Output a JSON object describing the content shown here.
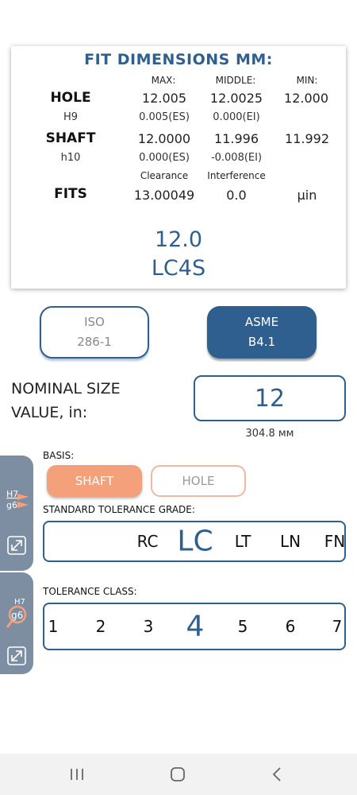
{
  "fit_card": {
    "title": "FIT DIMENSIONS MM:",
    "col_headers": {
      "max": "MAX:",
      "middle": "MIDDLE:",
      "min": "MIN:"
    },
    "hole": {
      "label": "HOLE",
      "grade": "H9",
      "max": "12.005",
      "middle": "12.0025",
      "min": "12.000",
      "dev_upper": "0.005(ES)",
      "dev_lower": "0.000(EI)"
    },
    "shaft": {
      "label": "SHAFT",
      "grade": "h10",
      "max": "12.0000",
      "middle": "11.996",
      "min": "11.992",
      "dev_upper": "0.000(ES)",
      "dev_lower": "-0.008(EI)"
    },
    "fits": {
      "label": "FITS",
      "clearance_header": "Clearance",
      "interference_header": "Interference",
      "clearance": "13.00049",
      "interference": "0.0",
      "unit": "µin"
    },
    "result_size": "12.0",
    "result_fit": "LC4S"
  },
  "standards": {
    "iso": {
      "line1": "ISO",
      "line2": "286-1",
      "selected": false
    },
    "asme": {
      "line1": "ASME",
      "line2": "B4.1",
      "selected": true
    }
  },
  "nominal": {
    "label_line1": "NOMINAL SIZE",
    "label_line2": "VALUE, in:",
    "value": "12",
    "converted": "304.8 мм"
  },
  "side_tabs": {
    "tab1_top": "H7",
    "tab1_bottom": "g6",
    "tab2_top": "H7",
    "tab2_bottom": "g6"
  },
  "basis": {
    "label": "BASIS:",
    "options": [
      "SHAFT",
      "HOLE"
    ],
    "selected": "SHAFT"
  },
  "grade": {
    "label": "STANDARD TOLERANCE GRADE:",
    "options": [
      "RC",
      "LC",
      "LT",
      "LN",
      "FN"
    ],
    "selected": "LC"
  },
  "tclass": {
    "label": "TOLERANCE CLASS:",
    "options": [
      "1",
      "2",
      "3",
      "4",
      "5",
      "6",
      "7"
    ],
    "selected": "4"
  },
  "colors": {
    "accent": "#2f5f8f",
    "basis_active": "#f4a07a",
    "side_tab": "#7d8ea3"
  },
  "nav": {
    "icons": [
      "recents-icon",
      "home-icon",
      "back-icon"
    ]
  }
}
